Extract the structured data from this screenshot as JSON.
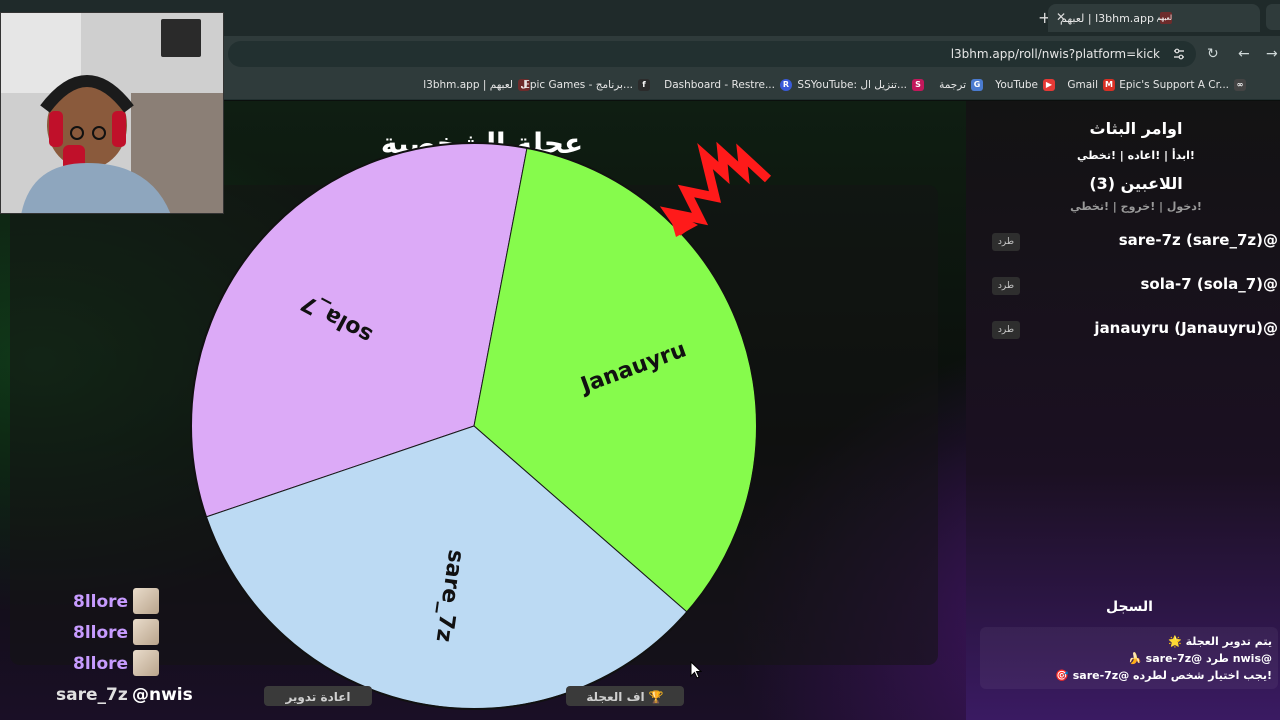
{
  "browser": {
    "tab_title": "l3bhm.app | لعبهم",
    "tab_favicon_text": "لعبهم",
    "url": "l3bhm.app/roll/nwis?platform=kick",
    "bookmarks": [
      {
        "label": "l3bhm.app | لعبهم",
        "icon": "l3bhm-favicon",
        "color": "#6d2b2b",
        "glyph": "ل"
      },
      {
        "label": "Epic Games - برنامج...",
        "icon": "epic-games-icon",
        "color": "#2b2b2b",
        "glyph": "f"
      },
      {
        "label": "Dashboard - Restre...",
        "icon": "restream-icon",
        "color": "#3a5bd9",
        "glyph": "R"
      },
      {
        "label": "SSYouTube: تنزيل ال...",
        "icon": "ssyoutube-icon",
        "color": "#c2185b",
        "glyph": "S"
      },
      {
        "label": "ترجمة",
        "icon": "google-translate-icon",
        "color": "#4a7bd0",
        "glyph": "G"
      },
      {
        "label": "YouTube",
        "icon": "youtube-icon",
        "color": "#e53935",
        "glyph": "▶"
      },
      {
        "label": "Gmail",
        "icon": "gmail-icon",
        "color": "#d93025",
        "glyph": "M"
      },
      {
        "label": "Epic's Support A Cr...",
        "icon": "link-icon",
        "color": "#444444",
        "glyph": "∞"
      }
    ]
  },
  "wheel": {
    "title": "عجلة الشخصية",
    "segments": [
      {
        "label": "sola_7",
        "color": "#dcaaf7"
      },
      {
        "label": "Janauyru",
        "color": "#86fb4c"
      },
      {
        "label": "sare_7z",
        "color": "#bcdaf3"
      }
    ]
  },
  "controls": {
    "respin_label": "اعادة تدوير",
    "stop_label": "🏆 اف العجلة"
  },
  "sidebar": {
    "commands_title": "اوامر البثاث",
    "commands_list": "!ابدأ | !اعاده | !تخطي",
    "players_title": "اللاعبين (3)",
    "player_commands": "!دخول | !خروج | !تخطي",
    "kick_label": "طرد",
    "players": [
      {
        "name": "sare-7z (sare_7z)@"
      },
      {
        "name": "sola-7 (sola_7)@"
      },
      {
        "name": "janauyru (Janauyru)@"
      }
    ],
    "log_title": "السجل",
    "log": [
      "🌟 يتم تدوير العجلة",
      "🍌 sare-7z@ طرد nwis@",
      "🎯 sare-7z@ يجب اختيار شخص لطرده!"
    ]
  },
  "chat": {
    "messages": [
      {
        "user": "8llore",
        "color": "#c79bff"
      },
      {
        "user": "8llore",
        "color": "#c79bff"
      },
      {
        "user": "8llore",
        "color": "#c79bff"
      }
    ],
    "last_user": "sare_7z",
    "last_text": "@nwis"
  }
}
